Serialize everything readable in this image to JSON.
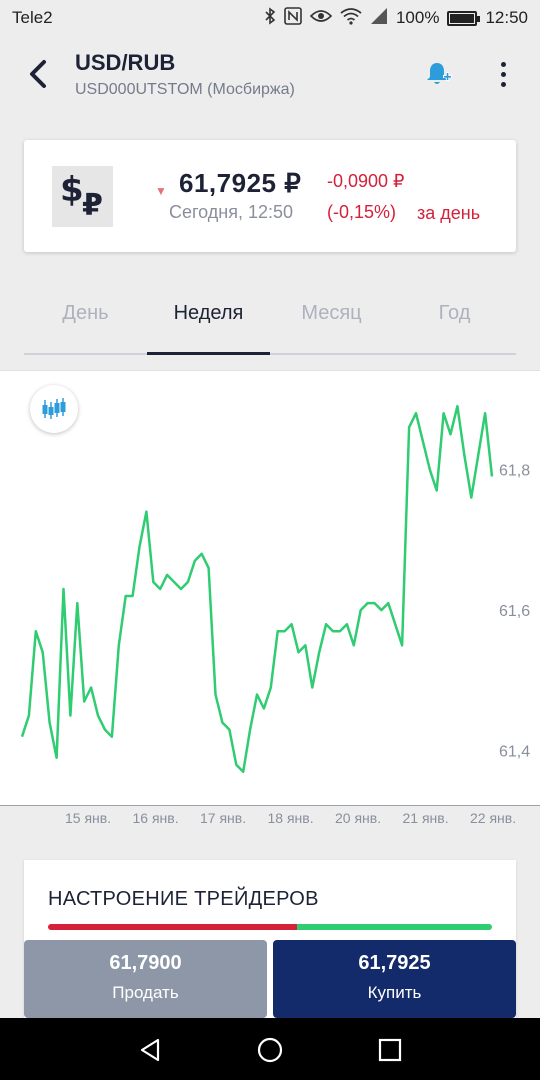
{
  "status_bar": {
    "carrier": "Tele2",
    "battery": "100%",
    "battery_level": 1.0,
    "time": "12:50",
    "icons": [
      "bluetooth-icon",
      "nfc-icon",
      "eye-icon",
      "wifi-icon",
      "signal-icon",
      "battery-icon"
    ]
  },
  "header": {
    "title": "USD/RUB",
    "subtitle": "USD000UTSTOM (Мосбиржа)"
  },
  "quote": {
    "logo_symbol_dollar": "$",
    "logo_symbol_ruble": "₽",
    "direction_arrow": "▼",
    "price": "61,7925 ₽",
    "change_abs": "-0,0900 ₽",
    "timestamp": "Сегодня, 12:50",
    "change_pct": "(-0,15%)",
    "period_label": "за день"
  },
  "tabs": [
    {
      "label": "День",
      "active": false
    },
    {
      "label": "Неделя",
      "active": true
    },
    {
      "label": "Месяц",
      "active": false
    },
    {
      "label": "Год",
      "active": false
    }
  ],
  "chart_data": {
    "type": "line",
    "series": [
      {
        "values": [
          61.42,
          61.45,
          61.57,
          61.54,
          61.44,
          61.39,
          61.63,
          61.45,
          61.61,
          61.47,
          61.49,
          61.45,
          61.43,
          61.42,
          61.55,
          61.62,
          61.62,
          61.69,
          61.74,
          61.64,
          61.63,
          61.65,
          61.64,
          61.63,
          61.64,
          61.67,
          61.68,
          61.66,
          61.48,
          61.44,
          61.43,
          61.38,
          61.37,
          61.43,
          61.48,
          61.46,
          61.49,
          61.57,
          61.57,
          61.58,
          61.54,
          61.55,
          61.49,
          61.54,
          61.58,
          61.57,
          61.57,
          61.58,
          61.55,
          61.6,
          61.61,
          61.61,
          61.6,
          61.61,
          61.58,
          61.55,
          61.86,
          61.88,
          61.84,
          61.8,
          61.77,
          61.88,
          61.85,
          61.89,
          61.82,
          61.76,
          61.82,
          61.88,
          61.79
        ]
      }
    ],
    "x_ticks": [
      "15 янв.",
      "16 янв.",
      "17 янв.",
      "18 янв.",
      "20 янв.",
      "21 янв.",
      "22 янв."
    ],
    "y_ticks": [
      "61,4",
      "61,6",
      "61,8"
    ],
    "y_tick_values": [
      61.4,
      61.6,
      61.8
    ],
    "ylim": [
      61.32,
      61.94
    ],
    "line_color": "#2fcc71",
    "grid": false
  },
  "sentiment": {
    "title": "НАСТРОЕНИЕ ТРЕЙДЕРОВ",
    "bearish_fraction": 0.56,
    "bullish_fraction": 0.44,
    "bear_color": "#d5213a",
    "bull_color": "#2fcc71"
  },
  "trade": {
    "sell_price": "61,7900",
    "sell_label": "Продать",
    "buy_price": "61,7925",
    "buy_label": "Купить"
  },
  "nav": {
    "icons": [
      "back-triangle-icon",
      "home-circle-icon",
      "recents-square-icon"
    ]
  }
}
